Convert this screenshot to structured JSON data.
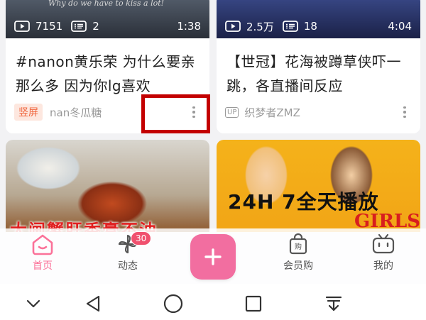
{
  "cards": [
    {
      "thumb_caption": "Why do we have to kiss a lot!",
      "views": "7151",
      "comments": "2",
      "duration": "1:38",
      "title": "#nanon黄乐荣 为什么要亲那么多 因为你lg喜欢",
      "tag": "竖屏",
      "author": "nan冬瓜糖"
    },
    {
      "views": "2.5万",
      "comments": "18",
      "duration": "4:04",
      "title": "【世冠】花海被蹲草侠吓一跳，各直播间反应",
      "up_badge": "UP",
      "author": "织梦者ZMZ"
    },
    {
      "overlay_text": "大闸蟹肝香膏不油"
    },
    {
      "overlay_text": "24H 7全天播放",
      "logo_text": "GIRLS"
    }
  ],
  "tabbar": {
    "home": "首页",
    "dynamic": "动态",
    "dynamic_badge": "30",
    "vip": "会员购",
    "mine": "我的"
  },
  "colors": {
    "accent": "#fb7299",
    "highlight": "#c30000"
  },
  "icons": {
    "home": "home-icon",
    "dynamic": "pinwheel-icon",
    "plus": "plus-icon",
    "vip": "shopping-bag-icon",
    "mine": "tv-icon",
    "nav": [
      "chevron-down-icon",
      "back-triangle-icon",
      "home-circle-icon",
      "recents-square-icon",
      "download-icon"
    ]
  }
}
